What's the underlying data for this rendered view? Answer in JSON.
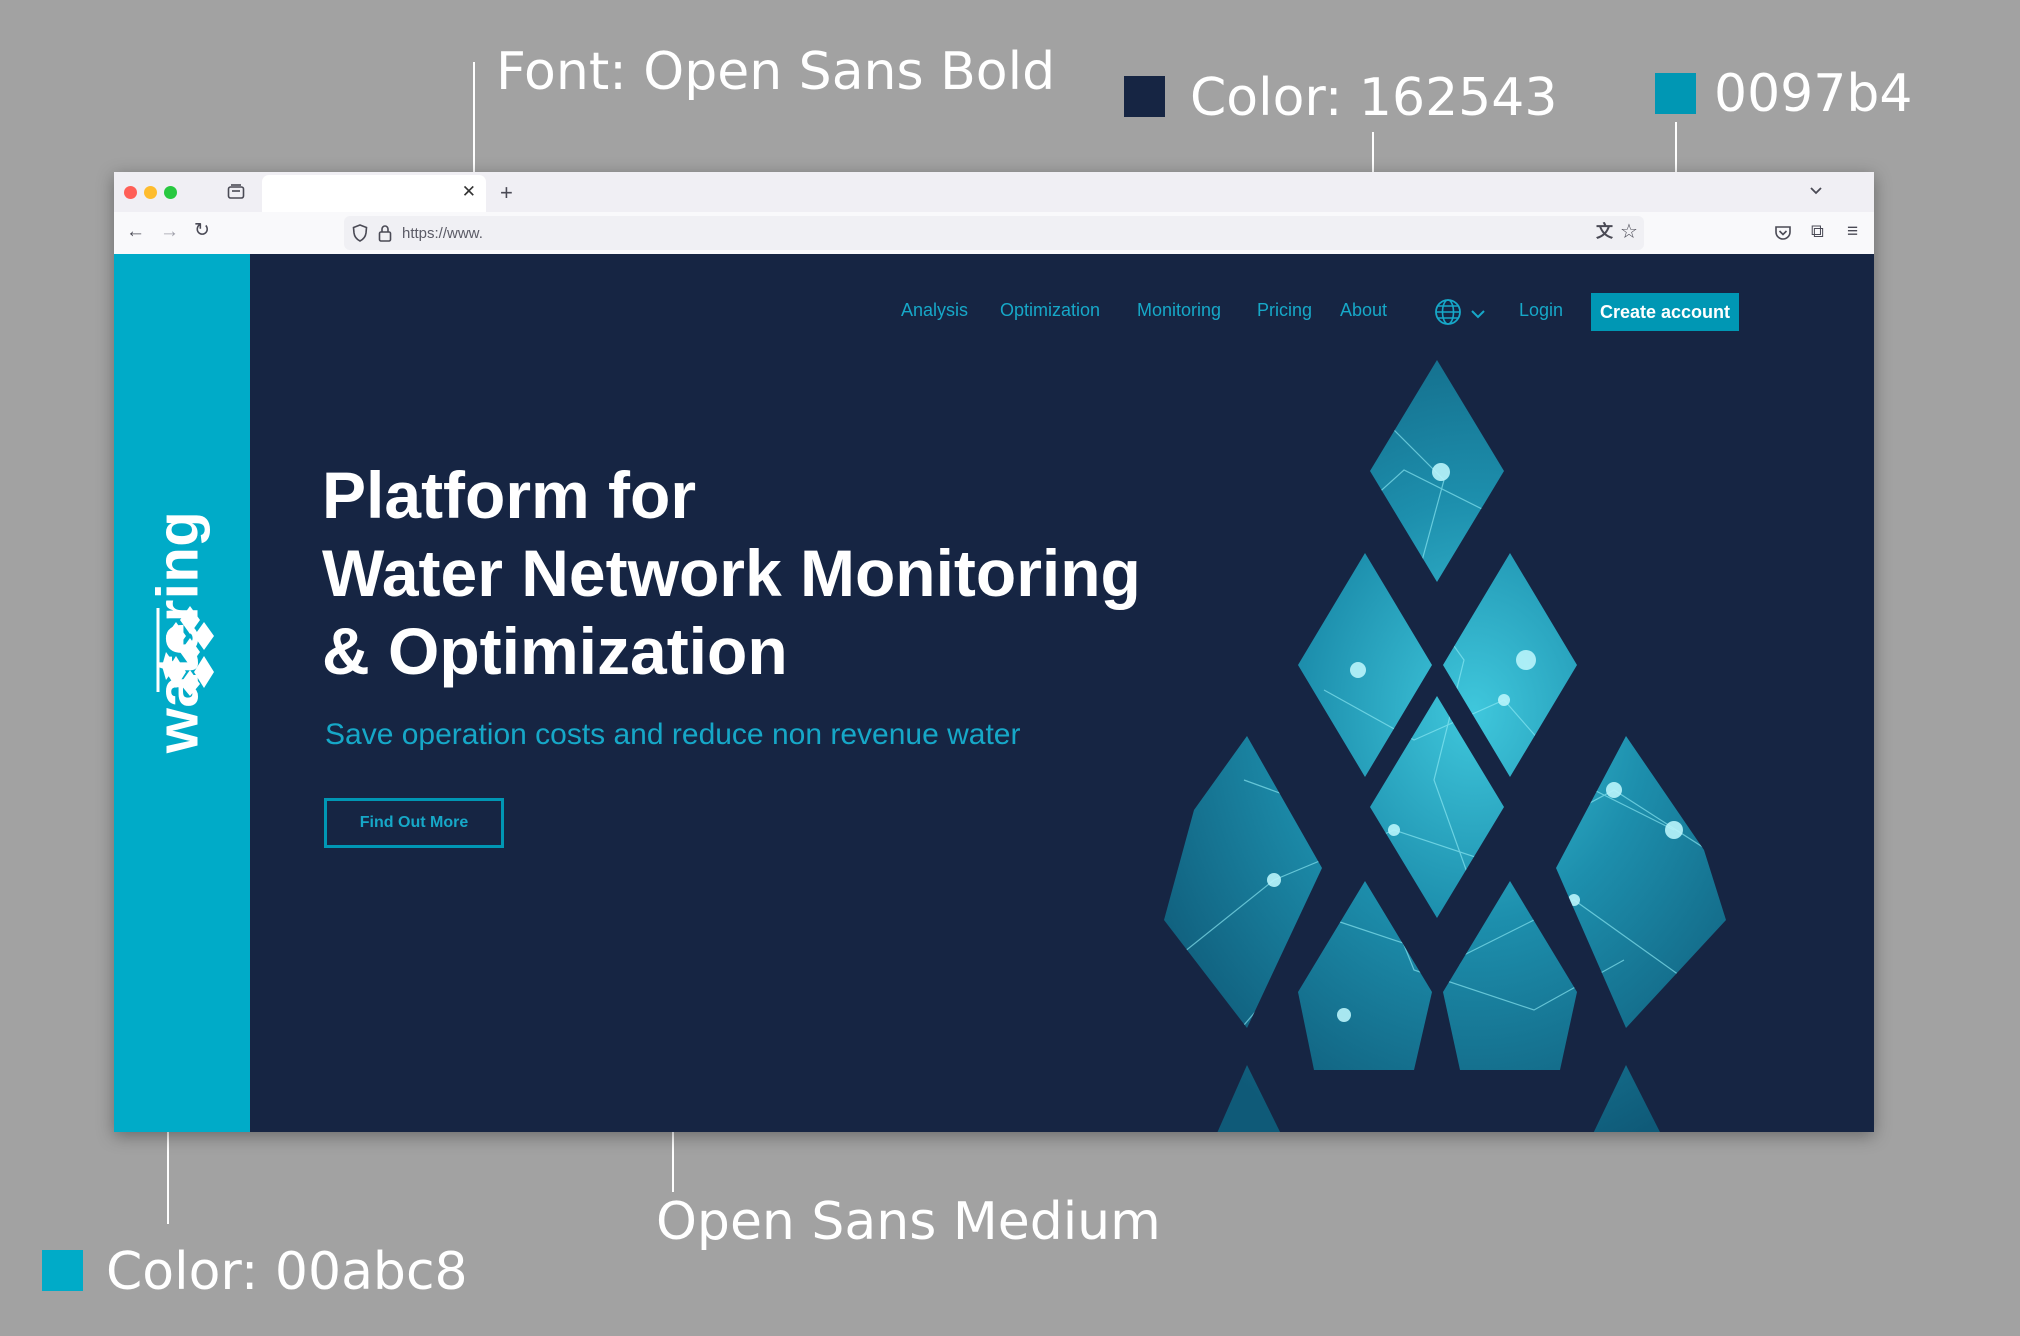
{
  "annotations": {
    "font_bold": "Font: Open Sans Bold",
    "color_dark": "Color: 162543",
    "color_button": "0097b4",
    "font_medium": "Open Sans Medium",
    "color_sidebar": "Color: 00abc8"
  },
  "colors": {
    "dark": "#162543",
    "button": "#0097b4",
    "sidebar": "#00abc8"
  },
  "browser": {
    "url": "https://www."
  },
  "page": {
    "logo_text": "watering",
    "nav": [
      "Analysis",
      "Optimization",
      "Monitoring",
      "Pricing",
      "About"
    ],
    "login": "Login",
    "create_account": "Create account",
    "hero_title": [
      "Platform for",
      "Water Network Monitoring",
      "& Optimization"
    ],
    "hero_subtitle": "Save operation costs and reduce non revenue water",
    "cta": "Find Out More",
    "icons": [
      "globe-icon",
      "chevron-down-icon",
      "watering-logo-icon",
      "drop-network-graphic"
    ]
  }
}
